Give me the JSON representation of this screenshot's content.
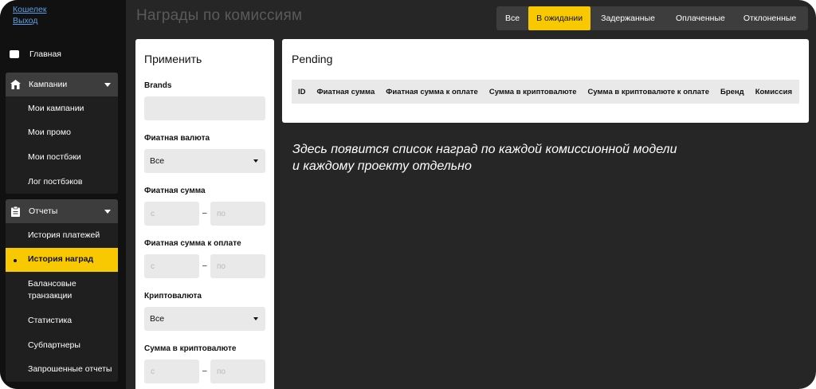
{
  "sidebar": {
    "top_links": [
      "Кошелек",
      "Выход"
    ],
    "home": "Главная",
    "campaigns": {
      "label": "Кампании",
      "items": [
        "Мои кампании",
        "Мои промо",
        "Мои постбэки",
        "Лог постбэков"
      ]
    },
    "reports": {
      "label": "Отчеты",
      "items": [
        "История платежей",
        "История наград",
        "Балансовые транзакции",
        "Статистика",
        "Субпартнеры",
        "Запрошенные отчеты"
      ]
    }
  },
  "header": {
    "title": "Награды по комиссиям",
    "tabs": [
      "Все",
      "В ожидании",
      "Задержанные",
      "Оплаченные",
      "Отклоненные"
    ],
    "active_tab": "В ожидании"
  },
  "filters": {
    "title": "Применить",
    "brands_label": "Brands",
    "fiat_currency_label": "Фиатная валюта",
    "fiat_currency_value": "Все",
    "fiat_amount_label": "Фиатная сумма",
    "fiat_payable_label": "Фиатная сумма к оплате",
    "crypto_label": "Криптовалюта",
    "crypto_value": "Все",
    "crypto_amount_label": "Сумма в криптовалюте",
    "from_placeholder": "с",
    "to_placeholder": "по",
    "dash": "–"
  },
  "table": {
    "title": "Pending",
    "columns": [
      "ID",
      "Фиатная сумма",
      "Фиатная сумма к оплате",
      "Сумма в криптовалюте",
      "Сумма в криптовалюте к оплате",
      "Бренд",
      "Комиссия"
    ]
  },
  "note": {
    "line1": "Здесь  появится список наград по каждой комиссионной модели",
    "line2": "и каждому проекту отдельно"
  },
  "colors": {
    "accent": "#f8c900",
    "background": "#262626",
    "sidebar": "#111111",
    "link": "#5f9ee6"
  }
}
